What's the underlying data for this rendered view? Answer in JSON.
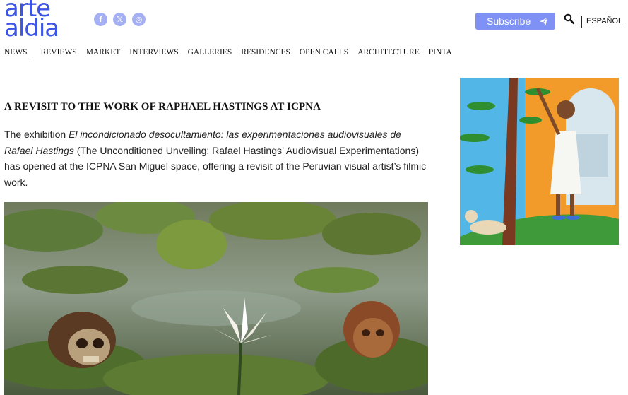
{
  "brand": {
    "logo_line1": "arte",
    "logo_line2": "aldia"
  },
  "social": {
    "facebook": "f",
    "x": "𝕏",
    "instagram": "◎"
  },
  "header": {
    "subscribe_label": "Subscribe",
    "language_label": "ESPAÑOL"
  },
  "nav": {
    "items": [
      "NEWS",
      "REVIEWS",
      "MARKET",
      "INTERVIEWS",
      "GALLERIES",
      "RESIDENCES",
      "OPEN CALLS",
      "ARCHITECTURE",
      "PINTA"
    ],
    "active": "NEWS"
  },
  "article": {
    "title": "A REVISIT TO THE WORK OF RAPHAEL HASTINGS AT ICPNA",
    "lead_before": "The exhibition ",
    "lead_italic": "El incondicionado desocultamiento: las experimentaciones audiovisuales de Rafael Hastings",
    "lead_after": " (The Unconditioned Unveiling: Rafael Hastings’ Audiovisual Experimentations) has opened at the ICPNA San Miguel space, offering a revisit of the Peruvian visual artist’s filmic work."
  },
  "colors": {
    "brand_blue": "#3d55e6",
    "subscribe_bg": "#7f91f5",
    "social_bg": "#a5b0f2"
  }
}
